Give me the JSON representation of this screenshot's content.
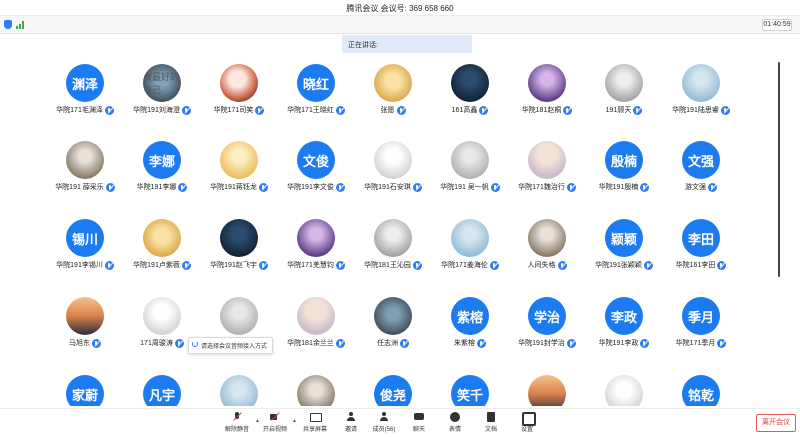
{
  "window": {
    "title": "腾讯会议 会议号: 369 658 660"
  },
  "status": {
    "timer": "01:40:59",
    "speaking_label": "正在讲话:"
  },
  "tooltip": {
    "text": "请选择会议音频接入方式"
  },
  "colors": {
    "accent": "#1d7bf1",
    "leave": "#e03a3a"
  },
  "participants": [
    {
      "name": "华院171毛渊泽",
      "avatar_text": "渊泽",
      "avatar_kind": "text"
    },
    {
      "name": "华院191刘海澄",
      "avatar_text": "",
      "avatar_kind": "image",
      "avatar_caption": "做最好的自己"
    },
    {
      "name": "华院171司笑",
      "avatar_text": "",
      "avatar_kind": "image"
    },
    {
      "name": "华院171王晓红",
      "avatar_text": "晓红",
      "avatar_kind": "text"
    },
    {
      "name": "张愿",
      "avatar_text": "",
      "avatar_kind": "image"
    },
    {
      "name": "161高鑫",
      "avatar_text": "",
      "avatar_kind": "image"
    },
    {
      "name": "华院181赵桐",
      "avatar_text": "",
      "avatar_kind": "image"
    },
    {
      "name": "191顾天",
      "avatar_text": "",
      "avatar_kind": "image"
    },
    {
      "name": "华院191陆思睿",
      "avatar_text": "",
      "avatar_kind": "image"
    },
    {
      "name": "华院191 薛采乐",
      "avatar_text": "",
      "avatar_kind": "image"
    },
    {
      "name": "华院191李娜",
      "avatar_text": "李娜",
      "avatar_kind": "text"
    },
    {
      "name": "华院191蒋钰龙",
      "avatar_text": "",
      "avatar_kind": "image"
    },
    {
      "name": "华院191李文俊",
      "avatar_text": "文俊",
      "avatar_kind": "text"
    },
    {
      "name": "华院191石安琪",
      "avatar_text": "",
      "avatar_kind": "image"
    },
    {
      "name": "华院191 吴一帆",
      "avatar_text": "",
      "avatar_kind": "image"
    },
    {
      "name": "华院171魏治行",
      "avatar_text": "",
      "avatar_kind": "image"
    },
    {
      "name": "华院191殷楠",
      "avatar_text": "殷楠",
      "avatar_kind": "text"
    },
    {
      "name": "游文强",
      "avatar_text": "文强",
      "avatar_kind": "text"
    },
    {
      "name": "华院191李锡川",
      "avatar_text": "锡川",
      "avatar_kind": "text"
    },
    {
      "name": "华院191卢紫薇",
      "avatar_text": "",
      "avatar_kind": "image"
    },
    {
      "name": "华院191赵飞宇",
      "avatar_text": "",
      "avatar_kind": "image"
    },
    {
      "name": "华院171羌慧钧",
      "avatar_text": "",
      "avatar_kind": "image"
    },
    {
      "name": "华院181王沁园",
      "avatar_text": "",
      "avatar_kind": "image"
    },
    {
      "name": "华院171姜海伦",
      "avatar_text": "",
      "avatar_kind": "image"
    },
    {
      "name": "人间失格",
      "avatar_text": "",
      "avatar_kind": "image"
    },
    {
      "name": "华院191张颖颖",
      "avatar_text": "颖颖",
      "avatar_kind": "text"
    },
    {
      "name": "华院161李田",
      "avatar_text": "李田",
      "avatar_kind": "text"
    },
    {
      "name": "马旭东",
      "avatar_text": "",
      "avatar_kind": "image"
    },
    {
      "name": "171周骏涛",
      "avatar_text": "",
      "avatar_kind": "image"
    },
    {
      "name": "",
      "avatar_text": "",
      "avatar_kind": "image"
    },
    {
      "name": "华院181余兰兰",
      "avatar_text": "",
      "avatar_kind": "image"
    },
    {
      "name": "任志洲",
      "avatar_text": "",
      "avatar_kind": "image"
    },
    {
      "name": "朱紫榕",
      "avatar_text": "紫榕",
      "avatar_kind": "text"
    },
    {
      "name": "华院191封学治",
      "avatar_text": "学治",
      "avatar_kind": "text"
    },
    {
      "name": "华院191李政",
      "avatar_text": "李政",
      "avatar_kind": "text"
    },
    {
      "name": "华院171季月",
      "avatar_text": "季月",
      "avatar_kind": "text"
    },
    {
      "name": "",
      "avatar_text": "家蔚",
      "avatar_kind": "text"
    },
    {
      "name": "",
      "avatar_text": "凡宇",
      "avatar_kind": "text"
    },
    {
      "name": "",
      "avatar_text": "",
      "avatar_kind": "image"
    },
    {
      "name": "",
      "avatar_text": "",
      "avatar_kind": "image"
    },
    {
      "name": "",
      "avatar_text": "俊尧",
      "avatar_kind": "text"
    },
    {
      "name": "",
      "avatar_text": "笑千",
      "avatar_kind": "text"
    },
    {
      "name": "",
      "avatar_text": "",
      "avatar_kind": "image"
    },
    {
      "name": "",
      "avatar_text": "",
      "avatar_kind": "image"
    },
    {
      "name": "",
      "avatar_text": "铭乾",
      "avatar_kind": "text"
    }
  ],
  "toolbar": {
    "mute": "解除静音",
    "video": "开启视频",
    "share": "共享屏幕",
    "invite": "邀请",
    "members": "成员(56)",
    "chat": "聊天",
    "emoji": "表情",
    "docs": "文档",
    "settings": "设置",
    "leave": "离开会议"
  }
}
